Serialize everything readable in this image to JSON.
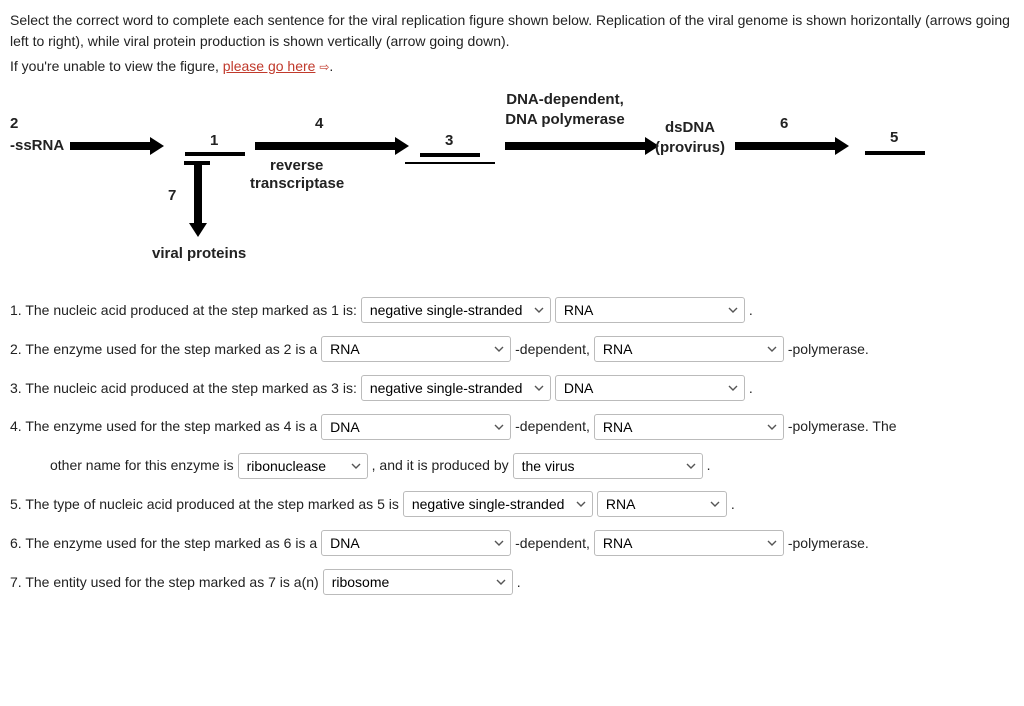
{
  "intro": {
    "line1": "Select the correct word to complete each sentence for the viral replication figure shown below. Replication of the viral genome is shown horizontally (arrows going left to right), while viral protein production is shown vertically (arrow going down).",
    "line2_prefix": "If you're unable to view the figure, ",
    "link_text": "please go here"
  },
  "figure": {
    "start_label": "-ssRNA",
    "n1": "1",
    "n2": "2",
    "n3": "3",
    "n4": "4",
    "n5": "5",
    "n6": "6",
    "n7": "7",
    "reverse": "reverse",
    "transcriptase": "transcriptase",
    "dna_dep": "DNA-dependent,",
    "dna_pol": "DNA polymerase",
    "dsdna": "dsDNA",
    "provirus": "(provirus)",
    "viral_proteins": "viral proteins"
  },
  "q1": {
    "prefix": "1. The nucleic acid produced at the step marked as 1 is:",
    "sel1": "negative single-stranded",
    "sel2": "RNA",
    "suffix": "."
  },
  "q2": {
    "prefix": "2. The enzyme used for the step marked as 2 is a",
    "sel1": "RNA",
    "mid": "-dependent,",
    "sel2": "RNA",
    "suffix": "-polymerase."
  },
  "q3": {
    "prefix": "3. The nucleic acid produced at the step marked as 3 is:",
    "sel1": "negative single-stranded",
    "sel2": "DNA",
    "suffix": "."
  },
  "q4": {
    "prefix": "4. The enzyme used for the step marked as 4 is a",
    "sel1": "DNA",
    "mid": "-dependent,",
    "sel2": "RNA",
    "suffix": "-polymerase. The"
  },
  "q4b": {
    "prefix": "other name for this enzyme is",
    "sel1": "ribonuclease",
    "mid": ", and it is produced by",
    "sel2": "the virus",
    "suffix": "."
  },
  "q5": {
    "prefix": "5. The type of nucleic acid produced at the step marked as 5 is",
    "sel1": "negative single-stranded",
    "sel2": "RNA",
    "suffix": "."
  },
  "q6": {
    "prefix": "6. The enzyme used for the step marked as 6 is a",
    "sel1": "DNA",
    "mid": "-dependent,",
    "sel2": "RNA",
    "suffix": "-polymerase."
  },
  "q7": {
    "prefix": "7. The entity used for the step marked as 7 is a(n)",
    "sel1": "ribosome",
    "suffix": "."
  }
}
